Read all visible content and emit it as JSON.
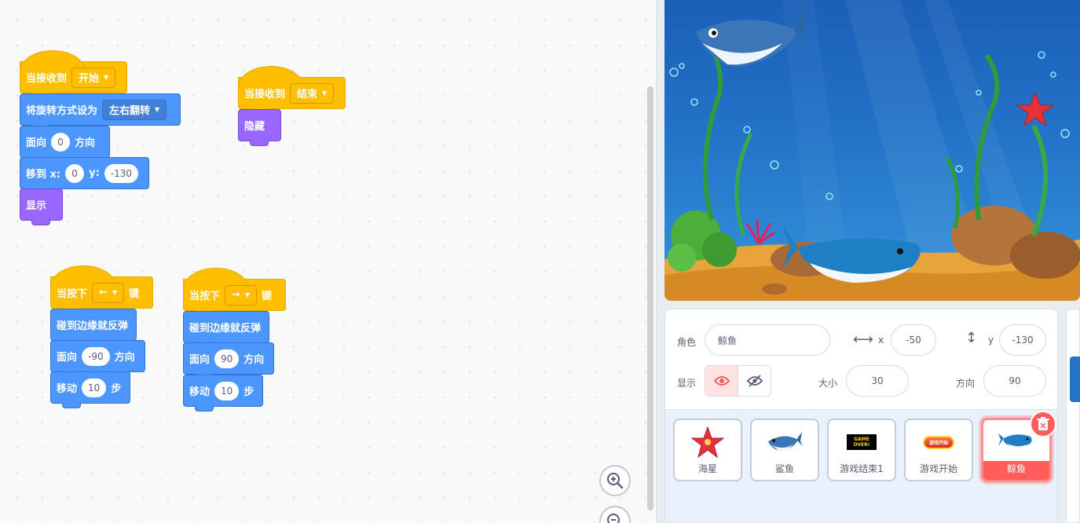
{
  "workspace": {
    "scripts": [
      {
        "blocks": [
          {
            "text": "当接收到",
            "dropdown": "开始"
          },
          {
            "text": "将旋转方式设为",
            "dropdown": "左右翻转"
          },
          {
            "pre": "面向",
            "value": "0",
            "post": "方向"
          },
          {
            "pre": "移到 x:",
            "x": "0",
            "ylabel": "y:",
            "y": "-130"
          },
          {
            "text": "显示"
          }
        ]
      },
      {
        "blocks": [
          {
            "text": "当接收到",
            "dropdown": "结束"
          },
          {
            "text": "隐藏"
          }
        ]
      },
      {
        "blocks": [
          {
            "pre": "当按下",
            "dropdown": "←",
            "post": "键"
          },
          {
            "text": "碰到边缘就反弹"
          },
          {
            "pre": "面向",
            "value": "-90",
            "post": "方向"
          },
          {
            "pre": "移动",
            "value": "10",
            "post": "步"
          }
        ]
      },
      {
        "blocks": [
          {
            "pre": "当按下",
            "dropdown": "→",
            "post": "键"
          },
          {
            "text": "碰到边缘就反弹"
          },
          {
            "pre": "面向",
            "value": "90",
            "post": "方向"
          },
          {
            "pre": "移动",
            "value": "10",
            "post": "步"
          }
        ]
      }
    ],
    "zoom_in_icon": "zoom-in-icon",
    "zoom_out_icon": "zoom-out-icon"
  },
  "sprite_info": {
    "sprite_label": "角色",
    "sprite_name": "鲸鱼",
    "x_label": "x",
    "x_value": "-50",
    "y_label": "y",
    "y_value": "-130",
    "show_label": "显示",
    "size_label": "大小",
    "size_value": "30",
    "direction_label": "方向",
    "direction_value": "90"
  },
  "sprites": [
    {
      "name": "海星",
      "icon": "starfish-icon"
    },
    {
      "name": "鲨鱼",
      "icon": "shark-icon"
    },
    {
      "name": "游戏结束1",
      "icon": "game-over-icon",
      "thumb_text": "GAME OVER!"
    },
    {
      "name": "游戏开始",
      "icon": "game-start-icon",
      "thumb_text": "游戏开始"
    },
    {
      "name": "鲸鱼",
      "icon": "whale-icon",
      "selected": true
    }
  ],
  "colors": {
    "event": "#ffbf00",
    "motion": "#4c97ff",
    "looks": "#9966ff",
    "selected_sprite": "#ff5c5c"
  }
}
